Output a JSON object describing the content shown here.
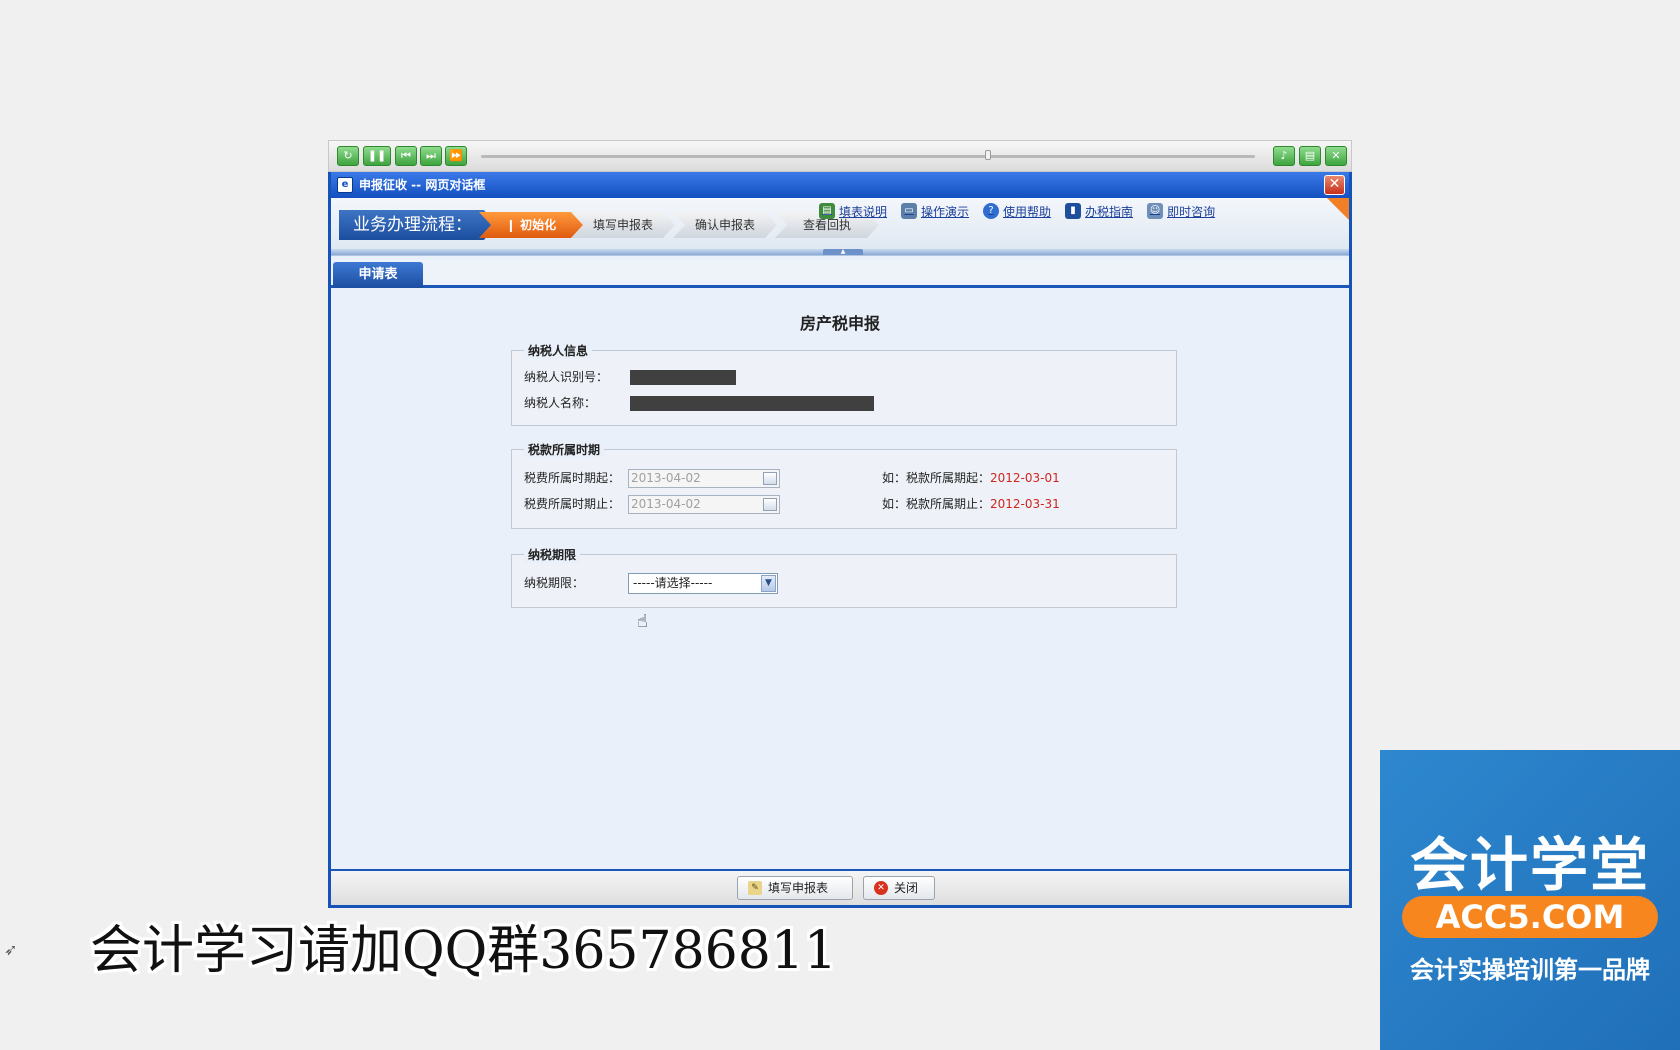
{
  "player": {
    "controls": [
      "replay",
      "pause",
      "prev",
      "next",
      "fast-forward"
    ],
    "right_controls": [
      "volume",
      "save",
      "close"
    ]
  },
  "dialog": {
    "title": "申报征收 -- 网页对话框",
    "close_label": "✕"
  },
  "process": {
    "label": "业务办理流程：",
    "steps": [
      {
        "label": "初始化",
        "active": true
      },
      {
        "label": "填写申报表",
        "active": false
      },
      {
        "label": "确认申报表",
        "active": false
      },
      {
        "label": "查看回执",
        "active": false
      }
    ],
    "help_links": [
      "填表说明",
      "操作演示",
      "使用帮助",
      "办税指南",
      "即时咨询"
    ]
  },
  "tabs": [
    {
      "label": "申请表"
    }
  ],
  "form": {
    "title": "房产税申报",
    "taxpayer": {
      "legend": "纳税人信息",
      "id_label": "纳税人识别号：",
      "name_label": "纳税人名称："
    },
    "period": {
      "legend": "税款所属时期",
      "start_label": "税费所属时期起：",
      "start_value": "2013-04-02",
      "end_label": "税费所属时期止：",
      "end_value": "2013-04-02",
      "start_hint_prefix": "如：税款所属期起：",
      "start_hint_value": "2012-03-01",
      "end_hint_prefix": "如：税款所属期止：",
      "end_hint_value": "2012-03-31"
    },
    "deadline": {
      "legend": "纳税期限",
      "label": "纳税期限：",
      "selected": "-----请选择-----"
    }
  },
  "footer": {
    "fill_button": "填写申报表",
    "close_button": "关闭"
  },
  "overlay": {
    "caption": "会计学习请加QQ群365786811",
    "brand_name": "会计学堂",
    "brand_url": "ACC5.COM",
    "brand_slogan": "会计实操培训第一品牌"
  },
  "colors": {
    "dialog_blue": "#1653b9",
    "active_step": "#e05a10",
    "hint_red": "#d0251e",
    "brand_blue": "#2e88cf",
    "brand_orange": "#f7861e"
  }
}
